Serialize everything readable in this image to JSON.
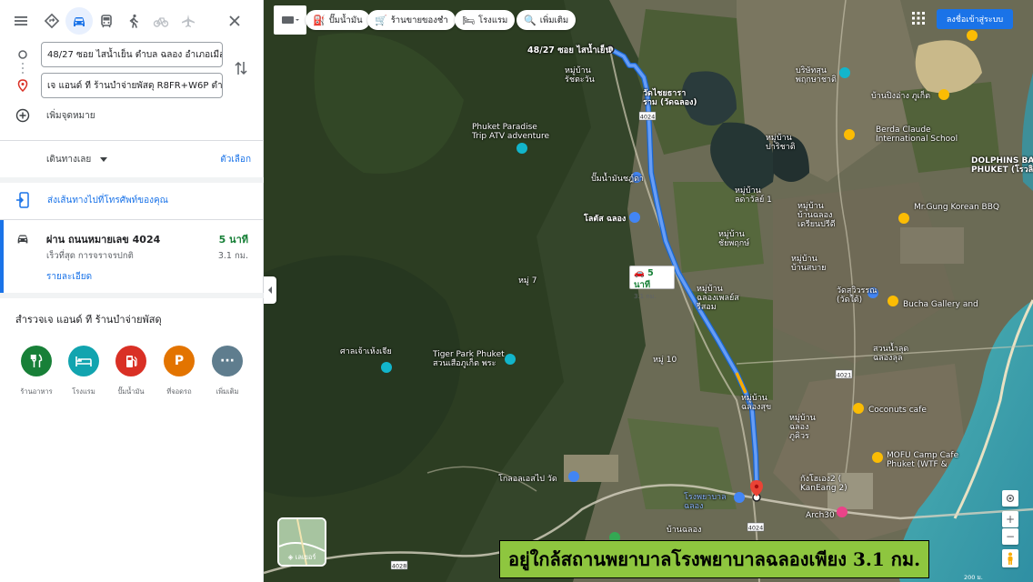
{
  "modes": [
    {
      "name": "best-route-icon",
      "active": false
    },
    {
      "name": "car-icon",
      "active": true
    },
    {
      "name": "transit-icon",
      "active": false
    },
    {
      "name": "walk-icon",
      "active": false
    },
    {
      "name": "bike-icon",
      "active": false
    },
    {
      "name": "flight-icon",
      "active": false
    }
  ],
  "origin": "48/27 ซอย ไสน้ำเย็น ตำบล ฉลอง อำเภอเมือง",
  "destination": "เจ แอนด์ ที ร้านบำจ่ายพัสดุ R8FR+W6P ตำบล",
  "add_destination": "เพิ่มจุดหมาย",
  "leave_now": "เดินทางเลย",
  "options": "ตัวเลือก",
  "send_to_phone": "ส่งเส้นทางไปที่โทรศัพท์ของคุณ",
  "route": {
    "name": "ผ่าน ถนนหมายเลข 4024",
    "subtitle": "เร็วที่สุด การจราจรปกติ",
    "time": "5 นาที",
    "distance": "3.1 กม.",
    "details": "รายละเอียด"
  },
  "explore_title": "สำรวจเจ แอนด์ ที ร้านบำจ่ายพัสดุ",
  "categories": [
    {
      "label": "ร้านอาหาร",
      "icon": "fork-knife-icon",
      "color": "#188038"
    },
    {
      "label": "โรงแรม",
      "icon": "bed-icon",
      "color": "#12a4af"
    },
    {
      "label": "ปั๊มน้ำมัน",
      "icon": "gas-icon",
      "color": "#d93025"
    },
    {
      "label": "ที่จอดรถ",
      "icon": "parking-icon",
      "color": "#e37400"
    },
    {
      "label": "เพิ่มเติม",
      "icon": "more-icon",
      "color": "#5f7d8e"
    }
  ],
  "map": {
    "chips": [
      "ปั๊มน้ำมัน",
      "ร้านขายของชำ",
      "โรงแรม",
      "เพิ่มเติม"
    ],
    "signin": "ลงชื่อเข้าสู่ระบบ",
    "origin_label": "48/27 ซอย ไสน้ำเย็น",
    "eta_time": "5 นาที",
    "eta_distance": "3.1 กม.",
    "layers_label": "เลเยอร์",
    "road_4024": "4024",
    "road_4021": "4021",
    "road_4028": "4028",
    "scale": "200 ม.",
    "labels": {
      "l1": "หมู่บ้าน",
      "l2": "รัชตะวัน",
      "l3": "วัดไชยธารา",
      "l4": "ราม (วัดฉลอง)",
      "l5": "Phuket Paradise",
      "l6": "Trip ATV adventure",
      "l7": "ปั๊มน้ำมันชฎ์ดา",
      "l8": "โลตัส ฉลอง",
      "l9": "หมู่บ้าน",
      "l10": "ลดาวัลย์ 1",
      "l11": "หมู่บ้าน",
      "l12": "บ้านฉลอง",
      "l13": "เดรียนปรีดี",
      "l14": "หมู่บ้าน",
      "l15": "ชัยพฤกษ์",
      "l16": "หมู่ 7",
      "l17": "หมู่บ้าน",
      "l18": "ฉลองเพลย์ส",
      "l19": "รีสอม",
      "l20": "ศาลเจ้าเห้งเจีย",
      "l21": "Tiger Park Phuket",
      "l22": "สวนเสือภูเก็ต พระ",
      "l23": "หมู่ 10",
      "l24": "หมู่บ้าน",
      "l25": "ฉลองสุข",
      "l26": "หมู่บ้าน",
      "l27": "ฉลอง",
      "l28": "ภูคิวร",
      "l29": "โกลอลเอสไป วัด",
      "l30": "บริษัทสุน",
      "l31": "พฤกษาชาติ",
      "l32": "Berda Claude",
      "l33": "International School",
      "l34": "หมู่บ้าน",
      "l35": "ปาริชาติ",
      "l36": "DOLPHINS BAY",
      "l37": "PHUKET (โรวลิมา)",
      "l38": "Mr.Gung Korean BBQ",
      "l39": "หมู่บ้าน",
      "l40": "บ้านสบาย",
      "l41": "วัดสุวิวรรณ",
      "l42": "(วัดใต้)",
      "l43": "Bucha Gallery and",
      "l44": "ฉลอง",
      "l45": "Coconuts cafe",
      "l46": "MOFU Camp Cafe",
      "l47": "Phuket (WTF &",
      "l48": "กังโฮเอง2 (",
      "l49": "KanEang 2)",
      "l50": "Arch30",
      "l51": "โรงพยาบาล",
      "l52": "ฉลอง",
      "l53": "บ้านฉลอง",
      "l54": "หมู่บ้านฉลอง",
      "l55": "หมู่บ้าน",
      "l56": "ชัยพฤกษ์",
      "l57": "สวนน้ำลุด",
      "l58": "ฉลองลุล",
      "l59": "บ้านปิงอ่าง ภูเก็ต"
    }
  },
  "caption": "อยู่ใกล้สถานพยาบาลโรงพยาบาลฉลองเพียง 3.1 กม.",
  "colors": {
    "route": "#4285f4",
    "accent": "#1a73e8",
    "caption_bg": "#8ec63f"
  }
}
